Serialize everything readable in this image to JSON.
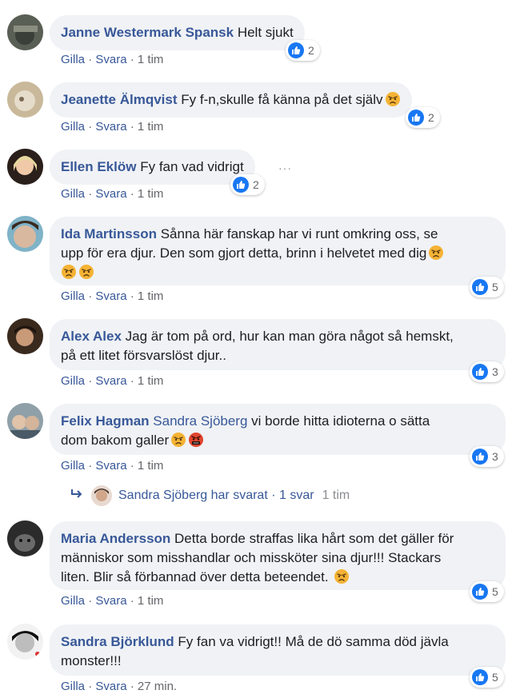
{
  "actions": {
    "like": "Gilla",
    "reply": "Svara",
    "separator": "·"
  },
  "colors": {
    "link": "#385898",
    "bubble": "#f0f2f5",
    "like_blue": "#1877f2",
    "muted": "#65676b"
  },
  "comments": [
    {
      "author": "Janne Westermark Spansk",
      "text": "Helt sjukt",
      "time": "1 tim",
      "likes": "2"
    },
    {
      "author": "Jeanette Älmqvist",
      "text": "Fy f-n,skulle få känna på det själv",
      "time": "1 tim",
      "likes": "2",
      "emojis": [
        "angry-face-icon"
      ]
    },
    {
      "author": "Ellen Eklöw",
      "text": "Fy fan vad vidrigt",
      "time": "1 tim",
      "likes": "2",
      "more": "···"
    },
    {
      "author": "Ida Martinsson",
      "text_line1": "Sånna här fanskap har vi runt omkring oss, se",
      "text_line2": "upp för era djur. Den som gjort detta, brinn i helvetet med dig",
      "time": "1 tim",
      "likes": "5",
      "emojis": [
        "angry-face-icon",
        "angry-face-icon",
        "angry-face-icon"
      ]
    },
    {
      "author": "Alex Alex",
      "text_line1": "Jag är tom på ord, hur kan man göra något så hemskt,",
      "text_line2": "på ett litet försvarslöst djur..",
      "time": "1 tim",
      "likes": "3"
    },
    {
      "author": "Felix Hagman",
      "mention": "Sandra Sjöberg",
      "text_line1": "vi borde hitta idioterna o sätta",
      "text_line2": "dom bakom galler",
      "time": "1 tim",
      "likes": "3",
      "emojis": [
        "angry-face-icon",
        "cursing-face-icon"
      ]
    },
    {
      "author": "Maria Andersson",
      "text_line1": "Detta borde straffas lika hårt som det gäller för",
      "text_line2": "människor som misshandlar och missköter sina djur!!! Stackars",
      "text_line3": "liten. Blir så förbannad över detta beteendet.",
      "time": "1 tim",
      "likes": "5",
      "emojis": [
        "angry-face-icon"
      ]
    },
    {
      "author": "Sandra Björklund",
      "text_line1": "Fy fan va vidrigt!! Må de dö samma död jävla",
      "text_line2": "monster!!!",
      "time": "27 min.",
      "likes": "5"
    }
  ],
  "reply_summary": {
    "text": "Sandra Sjöberg har svarat · 1 svar",
    "time": "1 tim"
  }
}
